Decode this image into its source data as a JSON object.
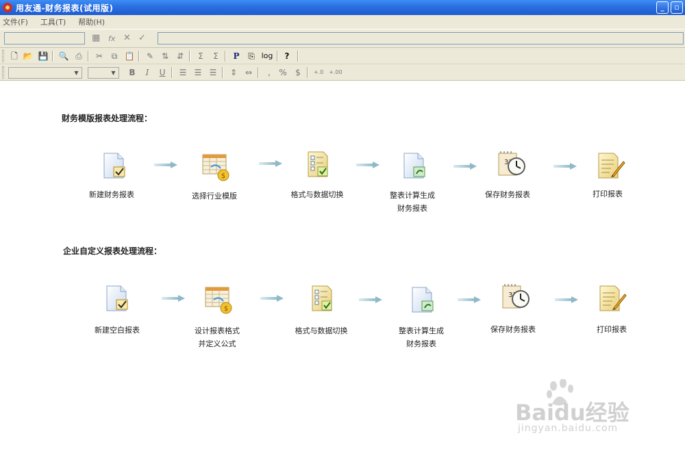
{
  "window": {
    "title": "用友通-财务报表(试用版)",
    "minimize": "_",
    "restore": "▫",
    "close": "✕"
  },
  "menu": {
    "items": [
      "文件(F)",
      "工具(T)",
      "帮助(H)"
    ]
  },
  "formula_bar": {
    "fx_label": "fx"
  },
  "toolbar_text": {
    "p_label": "P",
    "log_label": "log",
    "help_label": "?",
    "comma_label": ",",
    "percent_label": "%",
    "currency_label": "$",
    "bold_label": "B",
    "italic_label": "I",
    "underline_label": "U",
    "inc_decimal_label": "+.0",
    "dec_decimal_label": "+.00"
  },
  "section1": {
    "title": "财务模版报表处理流程：",
    "steps": [
      {
        "label": "新建财务报表"
      },
      {
        "label": "选择行业模版"
      },
      {
        "label": "格式与数据切换"
      },
      {
        "label1": "整表计算生成",
        "label2": "财务报表"
      },
      {
        "label": "保存财务报表"
      },
      {
        "label": "打印报表"
      }
    ]
  },
  "section2": {
    "title": "企业自定义报表处理流程：",
    "steps": [
      {
        "label": "新建空白报表"
      },
      {
        "label1": "设计报表格式",
        "label2": "并定义公式"
      },
      {
        "label": "格式与数据切换"
      },
      {
        "label1": "整表计算生成",
        "label2": "财务报表"
      },
      {
        "label": "保存财务报表"
      },
      {
        "label": "打印报表"
      }
    ]
  },
  "watermark": {
    "text": "Baidu经验",
    "sub": "jingyan.baidu.com"
  },
  "colors": {
    "titlebar": "#2a6fe0",
    "chrome": "#ece9d8",
    "arrow": "#9fc3cf"
  }
}
